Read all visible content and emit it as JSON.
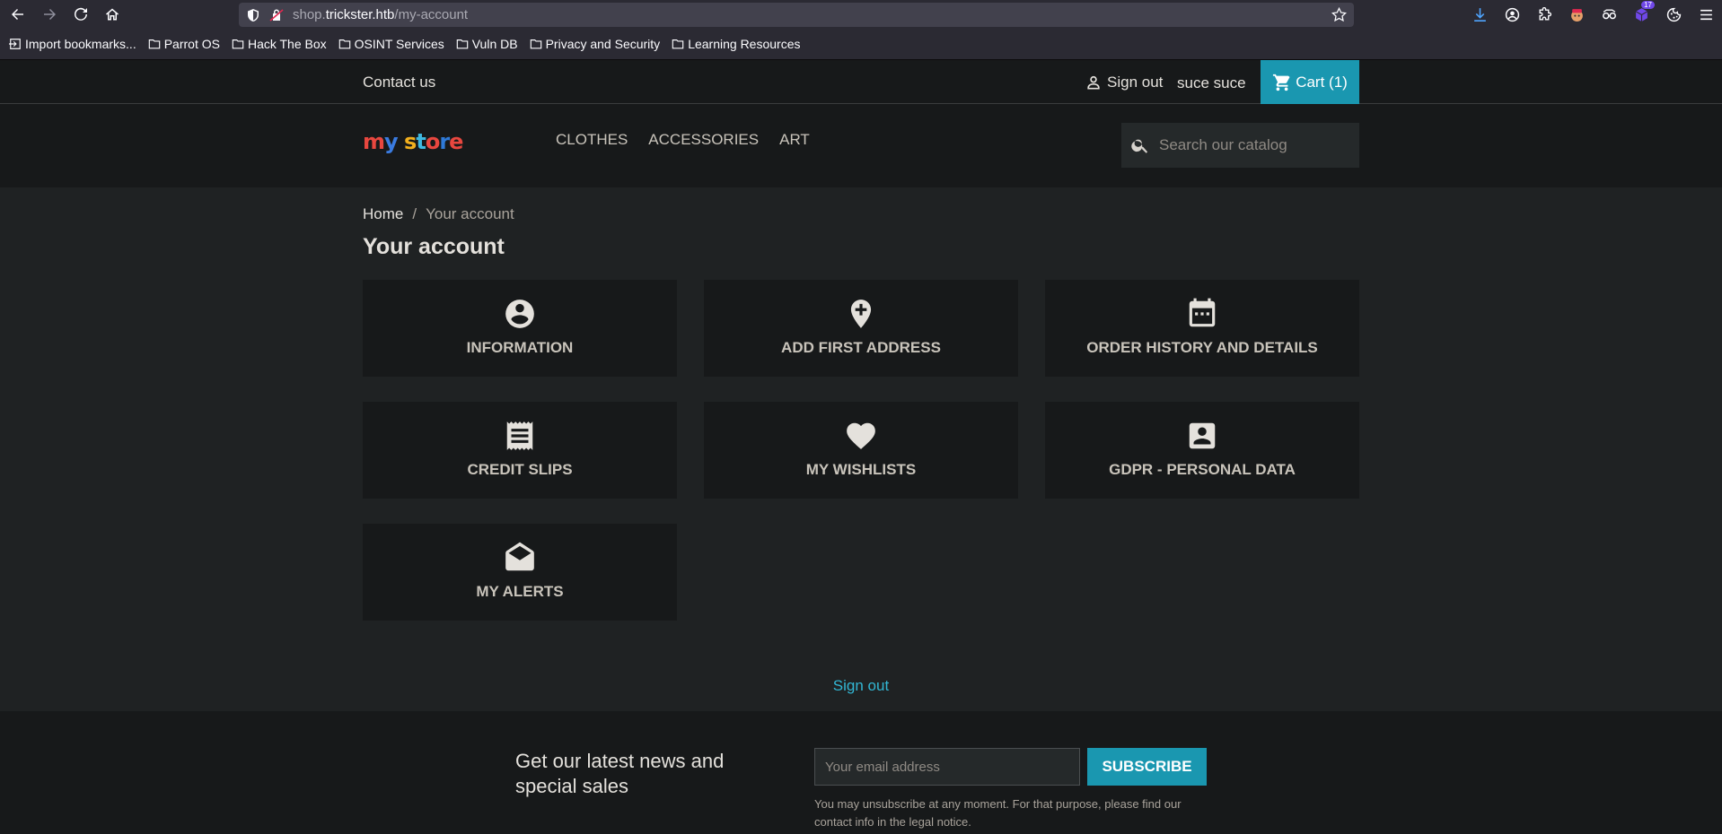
{
  "browser": {
    "url_prefix": "shop.",
    "url_host": "trickster.htb",
    "url_path": "/my-account",
    "bookmarks": [
      {
        "label": "Import bookmarks..."
      },
      {
        "label": "Parrot OS"
      },
      {
        "label": "Hack The Box"
      },
      {
        "label": "OSINT Services"
      },
      {
        "label": "Vuln DB"
      },
      {
        "label": "Privacy and Security"
      },
      {
        "label": "Learning Resources"
      }
    ],
    "ext_badge": "17"
  },
  "topnav": {
    "contact": "Contact us",
    "signout": "Sign out",
    "username": "suce suce",
    "cart": "Cart (1)"
  },
  "header": {
    "logo": "my store",
    "nav": [
      "CLOTHES",
      "ACCESSORIES",
      "ART"
    ],
    "search_placeholder": "Search our catalog"
  },
  "breadcrumb": {
    "home": "Home",
    "separator": "/",
    "current": "Your account"
  },
  "page_title": "Your account",
  "cards": [
    {
      "label": "INFORMATION",
      "icon": "account-circle-icon"
    },
    {
      "label": "ADD FIRST ADDRESS",
      "icon": "add-location-icon"
    },
    {
      "label": "ORDER HISTORY AND DETAILS",
      "icon": "calendar-icon"
    },
    {
      "label": "CREDIT SLIPS",
      "icon": "receipt-icon"
    },
    {
      "label": "MY WISHLISTS",
      "icon": "heart-icon"
    },
    {
      "label": "GDPR - PERSONAL DATA",
      "icon": "account-box-icon"
    },
    {
      "label": "MY ALERTS",
      "icon": "drafts-icon"
    }
  ],
  "signout_bottom": "Sign out",
  "footer": {
    "news_title": "Get our latest news and special sales",
    "email_placeholder": "Your email address",
    "subscribe": "SUBSCRIBE",
    "note": "You may unsubscribe at any moment. For that purpose, please find our contact info in the legal notice."
  },
  "colors": {
    "accent": "#1a97b0",
    "link": "#32b6d3",
    "background": "#1f2223",
    "card": "#17191a"
  }
}
